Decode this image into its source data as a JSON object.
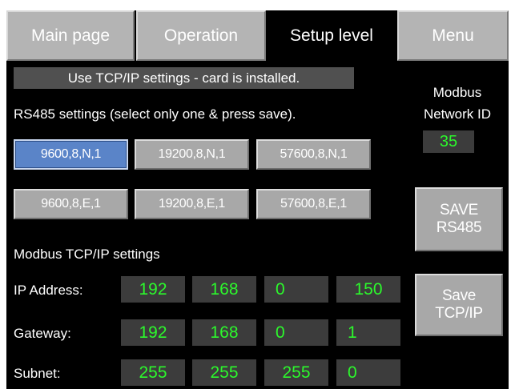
{
  "tabs": [
    {
      "label": "Main page"
    },
    {
      "label": "Operation"
    },
    {
      "label": "Setup level"
    },
    {
      "label": "Menu"
    }
  ],
  "notice": "Use TCP/IP settings - card is installed.",
  "rs485": {
    "heading": "RS485 settings (select only one & press save).",
    "options": [
      {
        "label": "9600,8,N,1"
      },
      {
        "label": "19200,8,N,1"
      },
      {
        "label": "57600,8,N,1"
      },
      {
        "label": "9600,8,E,1"
      },
      {
        "label": "19200,8,E,1"
      },
      {
        "label": "57600,8,E,1"
      }
    ],
    "selected": "9600,8,N,1"
  },
  "network_id": {
    "label_line1": "Modbus",
    "label_line2": "Network ID",
    "value": "35"
  },
  "buttons": {
    "save_rs485_line1": "SAVE",
    "save_rs485_line2": "RS485",
    "save_tcpip_line1": "Save",
    "save_tcpip_line2": "TCP/IP"
  },
  "tcpip": {
    "heading": "Modbus TCP/IP settings",
    "rows": [
      {
        "label": "IP Address:",
        "octets": [
          "192",
          "168",
          "0",
          "150"
        ]
      },
      {
        "label": "Gateway:",
        "octets": [
          "192",
          "168",
          "0",
          "1"
        ]
      },
      {
        "label": "Subnet:",
        "octets": [
          "255",
          "255",
          "255",
          "0"
        ]
      }
    ]
  },
  "colors": {
    "background": "#000000",
    "button": "#a8a8a8",
    "selected": "#5a84c8",
    "value_text": "#2cf82c",
    "field": "#3c3c3c"
  }
}
